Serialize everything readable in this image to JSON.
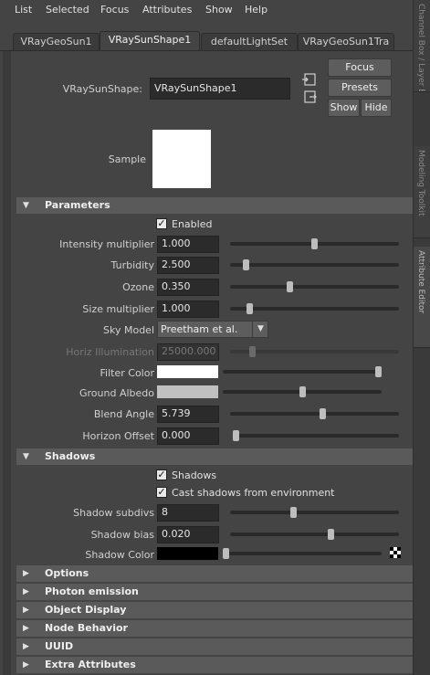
{
  "menu": [
    "List",
    "Selected",
    "Focus",
    "Attributes",
    "Show",
    "Help"
  ],
  "tabs": [
    "VRayGeoSun1",
    "VRaySunShape1",
    "defaultLightSet",
    "VRayGeoSun1Tra"
  ],
  "side_tabs": [
    "Channel Box / Layer Editor",
    "Modeling Toolkit",
    "Attribute Editor"
  ],
  "node": {
    "label": "VRaySunShape:",
    "value": "VRaySunShape1",
    "focus_label": "Focus",
    "presets_label": "Presets",
    "show_label": "Show",
    "hide_label": "Hide"
  },
  "sample_label": "Sample",
  "sections": {
    "parameters": "Parameters",
    "shadows": "Shadows",
    "collapsed": [
      "Options",
      "Photon emission",
      "Object Display",
      "Node Behavior",
      "UUID",
      "Extra Attributes"
    ]
  },
  "parameters": {
    "enabled_label": "Enabled",
    "intensity_label": "Intensity multiplier",
    "intensity_value": "1.000",
    "intensity_slider": 0.5,
    "turbidity_label": "Turbidity",
    "turbidity_value": "2.500",
    "turbidity_slider": 0.08,
    "ozone_label": "Ozone",
    "ozone_value": "0.350",
    "ozone_slider": 0.35,
    "size_label": "Size multiplier",
    "size_value": "1.000",
    "size_slider": 0.1,
    "sky_model_label": "Sky Model",
    "sky_model_value": "Preetham et al.",
    "horiz_label": "Horiz Illumination",
    "horiz_value": "25000.000",
    "horiz_slider": 0.12,
    "filter_color_label": "Filter Color",
    "filter_color": "#ffffff",
    "filter_slider": 1.0,
    "albedo_label": "Ground Albedo",
    "albedo_color": "#c0c0c0",
    "albedo_slider": 0.5,
    "blend_label": "Blend Angle",
    "blend_value": "5.739",
    "blend_slider": 0.55,
    "horizon_label": "Horizon Offset",
    "horizon_value": "0.000",
    "horizon_slider": 0.0
  },
  "shadows": {
    "shadows_label": "Shadows",
    "cast_label": "Cast shadows from environment",
    "subdivs_label": "Shadow subdivs",
    "subdivs_value": "8",
    "subdivs_slider": 0.37,
    "bias_label": "Shadow bias",
    "bias_value": "0.020",
    "bias_slider": 0.6,
    "color_label": "Shadow Color",
    "color": "#000000",
    "color_slider": 0.0
  }
}
